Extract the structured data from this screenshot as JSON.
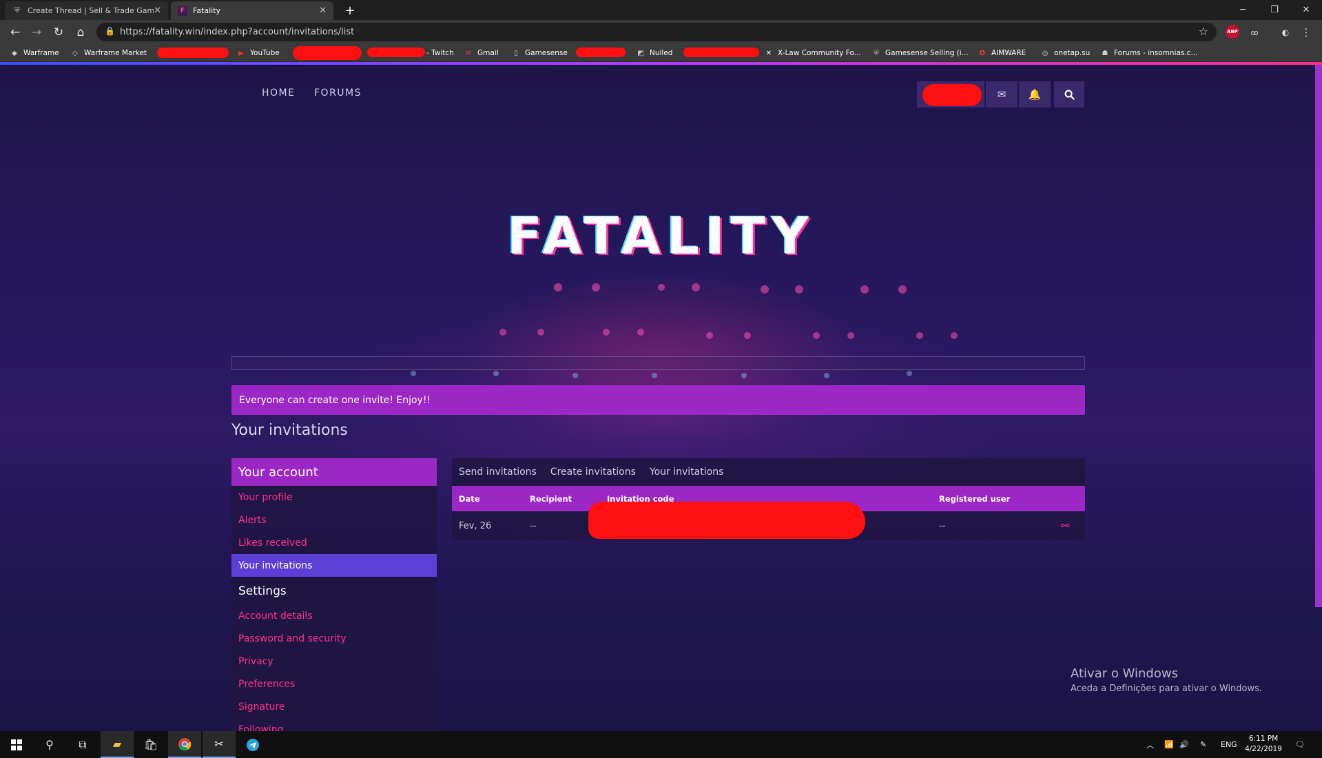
{
  "browser": {
    "tabs": [
      {
        "title": "Create Thread | Sell & Trade Game"
      },
      {
        "title": "Fatality"
      }
    ],
    "url": "https://fatality.win/index.php?account/invitations/list",
    "bookmarks": [
      {
        "label": "Warframe"
      },
      {
        "label": "Warframe Market"
      },
      {
        "label": "YouTube"
      },
      {
        "label": "- Twitch"
      },
      {
        "label": "Gmail"
      },
      {
        "label": "Gamesense"
      },
      {
        "label": "Nulled"
      },
      {
        "label": "X-Law Community Fo..."
      },
      {
        "label": "Gamesense Selling (i..."
      },
      {
        "label": "AIMWARE"
      },
      {
        "label": "onetap.su"
      },
      {
        "label": "Forums - insomnias.c..."
      }
    ],
    "extensions": {
      "abp": "ABP"
    }
  },
  "site": {
    "nav": {
      "home": "HOME",
      "forums": "FORUMS"
    },
    "logo": "FATALITY",
    "notice": "Everyone can create one invite! Enjoy!!",
    "page_title": "Your invitations"
  },
  "sidebar": {
    "account_heading": "Your account",
    "account_items": [
      {
        "label": "Your profile"
      },
      {
        "label": "Alerts"
      },
      {
        "label": "Likes received"
      },
      {
        "label": "Your invitations"
      }
    ],
    "settings_heading": "Settings",
    "settings_items": [
      {
        "label": "Account details"
      },
      {
        "label": "Password and security"
      },
      {
        "label": "Privacy"
      },
      {
        "label": "Preferences"
      },
      {
        "label": "Signature"
      },
      {
        "label": "Following"
      }
    ]
  },
  "invitations": {
    "tabs": [
      {
        "label": "Send invitations"
      },
      {
        "label": "Create invitations"
      },
      {
        "label": "Your invitations"
      }
    ],
    "columns": {
      "date": "Date",
      "recipient": "Recipient",
      "code": "Invitation code",
      "registered": "Registered user"
    },
    "rows": [
      {
        "date": "Fev, 26",
        "recipient": "--",
        "code": "",
        "registered": "--"
      }
    ]
  },
  "watermark": {
    "title": "Ativar o Windows",
    "subtitle": "Aceda a Definições para ativar o Windows."
  },
  "taskbar": {
    "language": "ENG",
    "time": "6:11 PM",
    "date": "4/22/2019"
  },
  "colors": {
    "accent": "#9b28c4",
    "active_item": "#5b3fd6",
    "link": "#ff2f8a",
    "redaction": "#ff1010"
  }
}
